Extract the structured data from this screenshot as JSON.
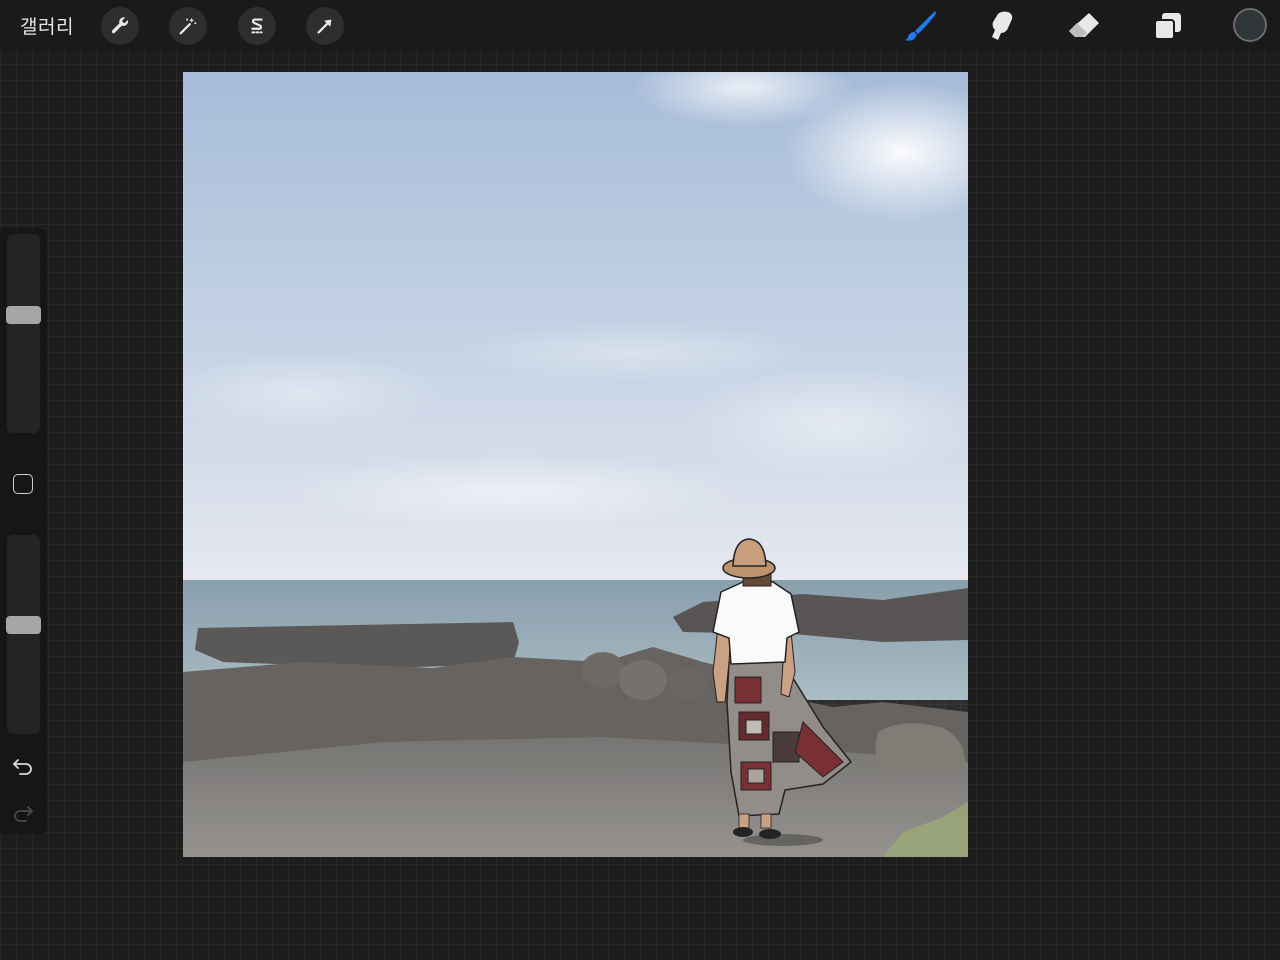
{
  "topbar": {
    "gallery_label": "갤러리",
    "left_tools": [
      {
        "name": "actions",
        "icon": "wrench-icon"
      },
      {
        "name": "adjustments",
        "icon": "magic-wand-icon"
      },
      {
        "name": "selection",
        "icon": "selection-s-icon"
      },
      {
        "name": "transform",
        "icon": "arrow-cursor-icon"
      }
    ],
    "right_tools": [
      {
        "name": "paint",
        "icon": "brush-icon",
        "active": true
      },
      {
        "name": "smudge",
        "icon": "smudge-finger-icon"
      },
      {
        "name": "eraser",
        "icon": "eraser-icon"
      },
      {
        "name": "layers",
        "icon": "layers-icon"
      }
    ],
    "current_color": "#2f3638"
  },
  "sidebar": {
    "brush_size_level": 0.6,
    "opacity_level": 0.55,
    "modify_button_icon": "square-icon",
    "undo_icon": "undo-icon",
    "redo_icon": "redo-icon"
  },
  "colors": {
    "accent": "#1f7cf0"
  }
}
